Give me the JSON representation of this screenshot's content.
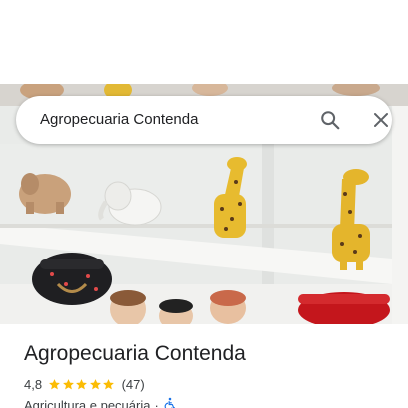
{
  "search": {
    "query": "Agropecuaria Contenda"
  },
  "photo": {
    "description_icon": "place-photo"
  },
  "place": {
    "name": "Agropecuaria Contenda",
    "rating": "4,8",
    "stars": 5,
    "review_count": "(47)",
    "category": "Agricultura e pecuária",
    "separator": "·",
    "accessibility_icon": "wheelchair-icon"
  },
  "colors": {
    "star": "#fbbc04",
    "accessibility": "#1a73e8",
    "text_primary": "#202124",
    "text_secondary": "#3c4043"
  }
}
